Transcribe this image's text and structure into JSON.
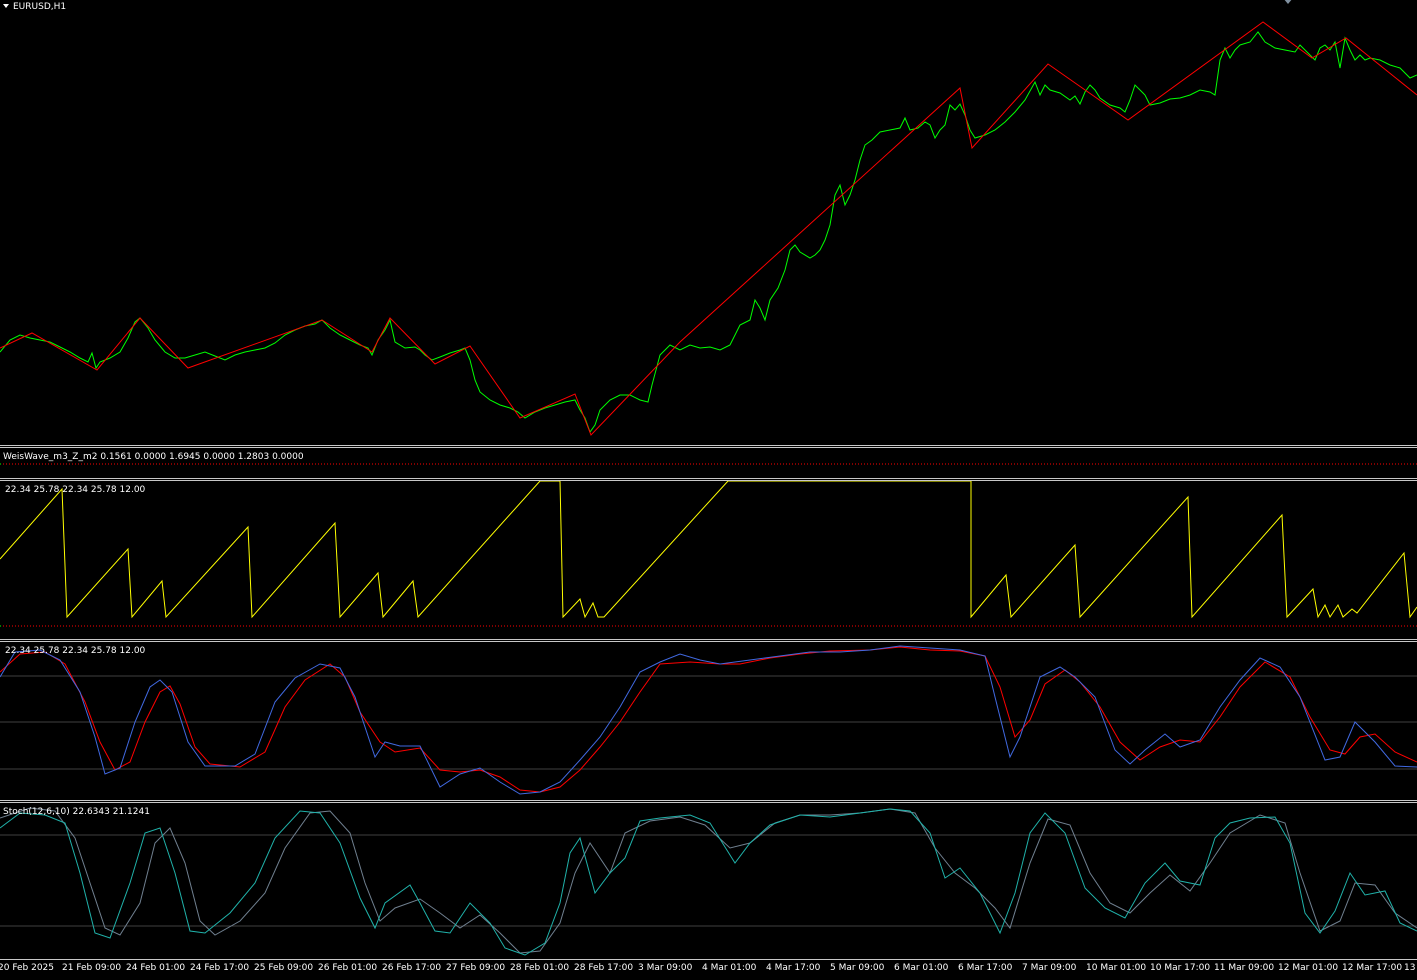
{
  "chart_window": {
    "symbol_label": "EURUSD,H1"
  },
  "weis_wave_pane": {
    "label": "WeisWave_m3_Z_m2 0.1561 0.0000 1.6945 0.0000 1.2803 0.0000"
  },
  "indicator_pane_2": {
    "label": "22.34 25.78 22.34 25.78 12.00"
  },
  "indicator_pane_3": {
    "label": "22.34 25.78 22.34 25.78 12.00"
  },
  "stoch_pane": {
    "label": "Stoch(12,6,10) 22.6343 21.1241"
  },
  "colors": {
    "background": "#000000",
    "price_line": "#00ff00",
    "zigzag": "#ff0000",
    "wave": "#ffff00",
    "signal_main": "#4169e1",
    "signal_red": "#ff0000",
    "stoch_main": "#20b2aa",
    "stoch_signal": "#708090",
    "dotted_green": "#00ff00",
    "dotted_red": "#ff0000",
    "grid": "#404040"
  },
  "time_axis": {
    "ticks": [
      "20 Feb 2025",
      "21 Feb 09:00",
      "24 Feb 01:00",
      "24 Feb 17:00",
      "25 Feb 09:00",
      "26 Feb 01:00",
      "26 Feb 17:00",
      "27 Feb 09:00",
      "28 Feb 01:00",
      "28 Feb 17:00",
      "3 Mar 09:00",
      "4 Mar 01:00",
      "4 Mar 17:00",
      "5 Mar 09:00",
      "6 Mar 01:00",
      "6 Mar 17:00",
      "7 Mar 09:00",
      "10 Mar 01:00",
      "10 Mar 17:00",
      "11 Mar 09:00",
      "12 Mar 01:00",
      "12 Mar 17:00",
      "13"
    ]
  }
}
